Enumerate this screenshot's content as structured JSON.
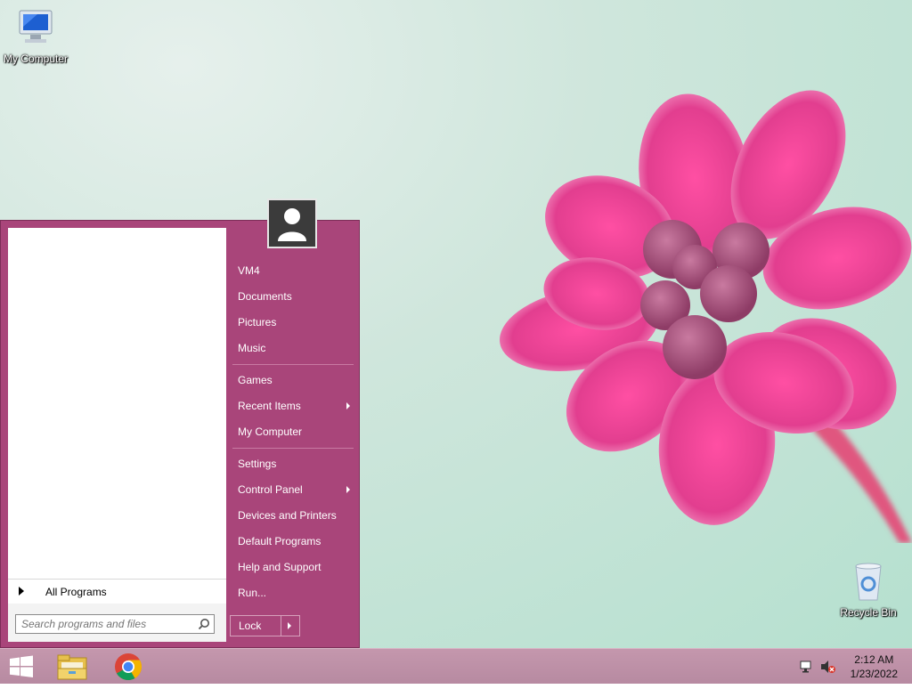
{
  "desktop": {
    "icons": [
      {
        "label": "My Computer",
        "icon": "computer-icon"
      },
      {
        "label": "Recycle Bin",
        "icon": "recycle-bin-icon"
      }
    ],
    "wallpaper": "pink-flower"
  },
  "start_menu": {
    "accent_color": "#a9457a",
    "all_programs_label": "All Programs",
    "search_placeholder": "Search programs and files",
    "user_icon": "user-icon",
    "items": [
      {
        "label": "VM4"
      },
      {
        "label": "Documents"
      },
      {
        "label": "Pictures"
      },
      {
        "label": "Music"
      },
      {
        "label": "Games"
      },
      {
        "label": "Recent Items",
        "submenu": true
      },
      {
        "label": "My Computer"
      },
      {
        "label": "Settings"
      },
      {
        "label": "Control Panel",
        "submenu": true
      },
      {
        "label": "Devices and Printers"
      },
      {
        "label": "Default Programs"
      },
      {
        "label": "Help and Support"
      },
      {
        "label": "Run..."
      }
    ],
    "lock_label": "Lock"
  },
  "taskbar": {
    "pinned": [
      {
        "icon": "windows-start-icon"
      },
      {
        "icon": "file-explorer-icon"
      },
      {
        "icon": "chrome-icon"
      }
    ],
    "tray_icons": [
      "network-icon",
      "volume-muted-icon"
    ],
    "time": "2:12 AM",
    "date": "1/23/2022"
  }
}
